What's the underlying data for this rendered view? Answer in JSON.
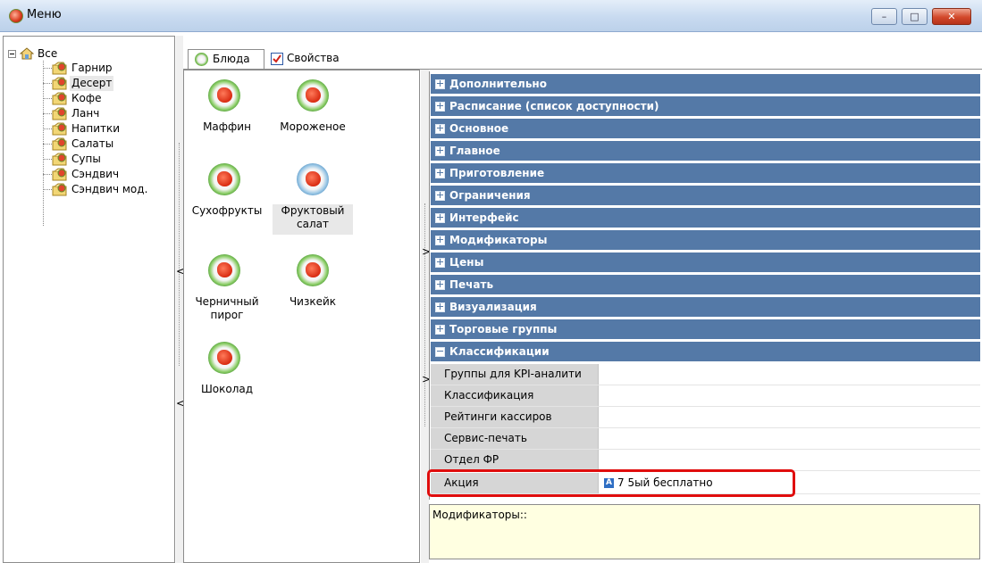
{
  "window": {
    "title": "Меню",
    "buttons": {
      "minimize": "–",
      "maximize": "□",
      "close": "✕"
    }
  },
  "tree": {
    "root": "Все",
    "items": [
      {
        "label": "Гарнир"
      },
      {
        "label": "Десерт",
        "selected": true
      },
      {
        "label": "Кофе"
      },
      {
        "label": "Ланч"
      },
      {
        "label": "Напитки"
      },
      {
        "label": "Салаты"
      },
      {
        "label": "Супы"
      },
      {
        "label": "Сэндвич"
      },
      {
        "label": "Сэндвич мод."
      }
    ]
  },
  "tabs": [
    {
      "label": "Блюда",
      "active": true,
      "icon": "dish-icon"
    },
    {
      "label": "Свойства",
      "active": false,
      "icon": "checkbox-icon"
    }
  ],
  "dishes": [
    {
      "line1": "Маффин",
      "line2": ""
    },
    {
      "line1": "Мороженое",
      "line2": ""
    },
    {
      "line1": "Сухофрукты",
      "line2": ""
    },
    {
      "line1": "Фруктовый",
      "line2": "салат",
      "selected": true
    },
    {
      "line1": "Черничный",
      "line2": "пирог"
    },
    {
      "line1": "Чизкейк",
      "line2": ""
    },
    {
      "line1": "Шоколад",
      "line2": ""
    }
  ],
  "splitters": {
    "arrow_left": "<",
    "arrow_right": ">"
  },
  "categories": [
    {
      "label": "Дополнительно",
      "expanded": false
    },
    {
      "label": "Расписание (список доступности)",
      "expanded": false
    },
    {
      "label": "Основное",
      "expanded": false
    },
    {
      "label": "Главное",
      "expanded": false
    },
    {
      "label": "Приготовление",
      "expanded": false
    },
    {
      "label": "Ограничения",
      "expanded": false
    },
    {
      "label": "Интерфейс",
      "expanded": false
    },
    {
      "label": "Модификаторы",
      "expanded": false
    },
    {
      "label": "Цены",
      "expanded": false
    },
    {
      "label": "Печать",
      "expanded": false
    },
    {
      "label": "Визуализация",
      "expanded": false
    },
    {
      "label": "Торговые группы",
      "expanded": false
    },
    {
      "label": "Классификации",
      "expanded": true
    }
  ],
  "properties": [
    {
      "name": "Группы для KPI-аналити",
      "value": ""
    },
    {
      "name": "Классификация",
      "value": ""
    },
    {
      "name": "Рейтинги кассиров",
      "value": ""
    },
    {
      "name": "Сервис-печать",
      "value": ""
    },
    {
      "name": "Отдел ФР",
      "value": ""
    },
    {
      "name": "Акция",
      "value": "7 5ый бесплатно",
      "value_icon": "A"
    }
  ],
  "description": {
    "text": "Модификаторы::"
  },
  "colors": {
    "category_header": "#5479a7",
    "highlight": "#e00d0d",
    "description_bg": "#ffffe1"
  }
}
